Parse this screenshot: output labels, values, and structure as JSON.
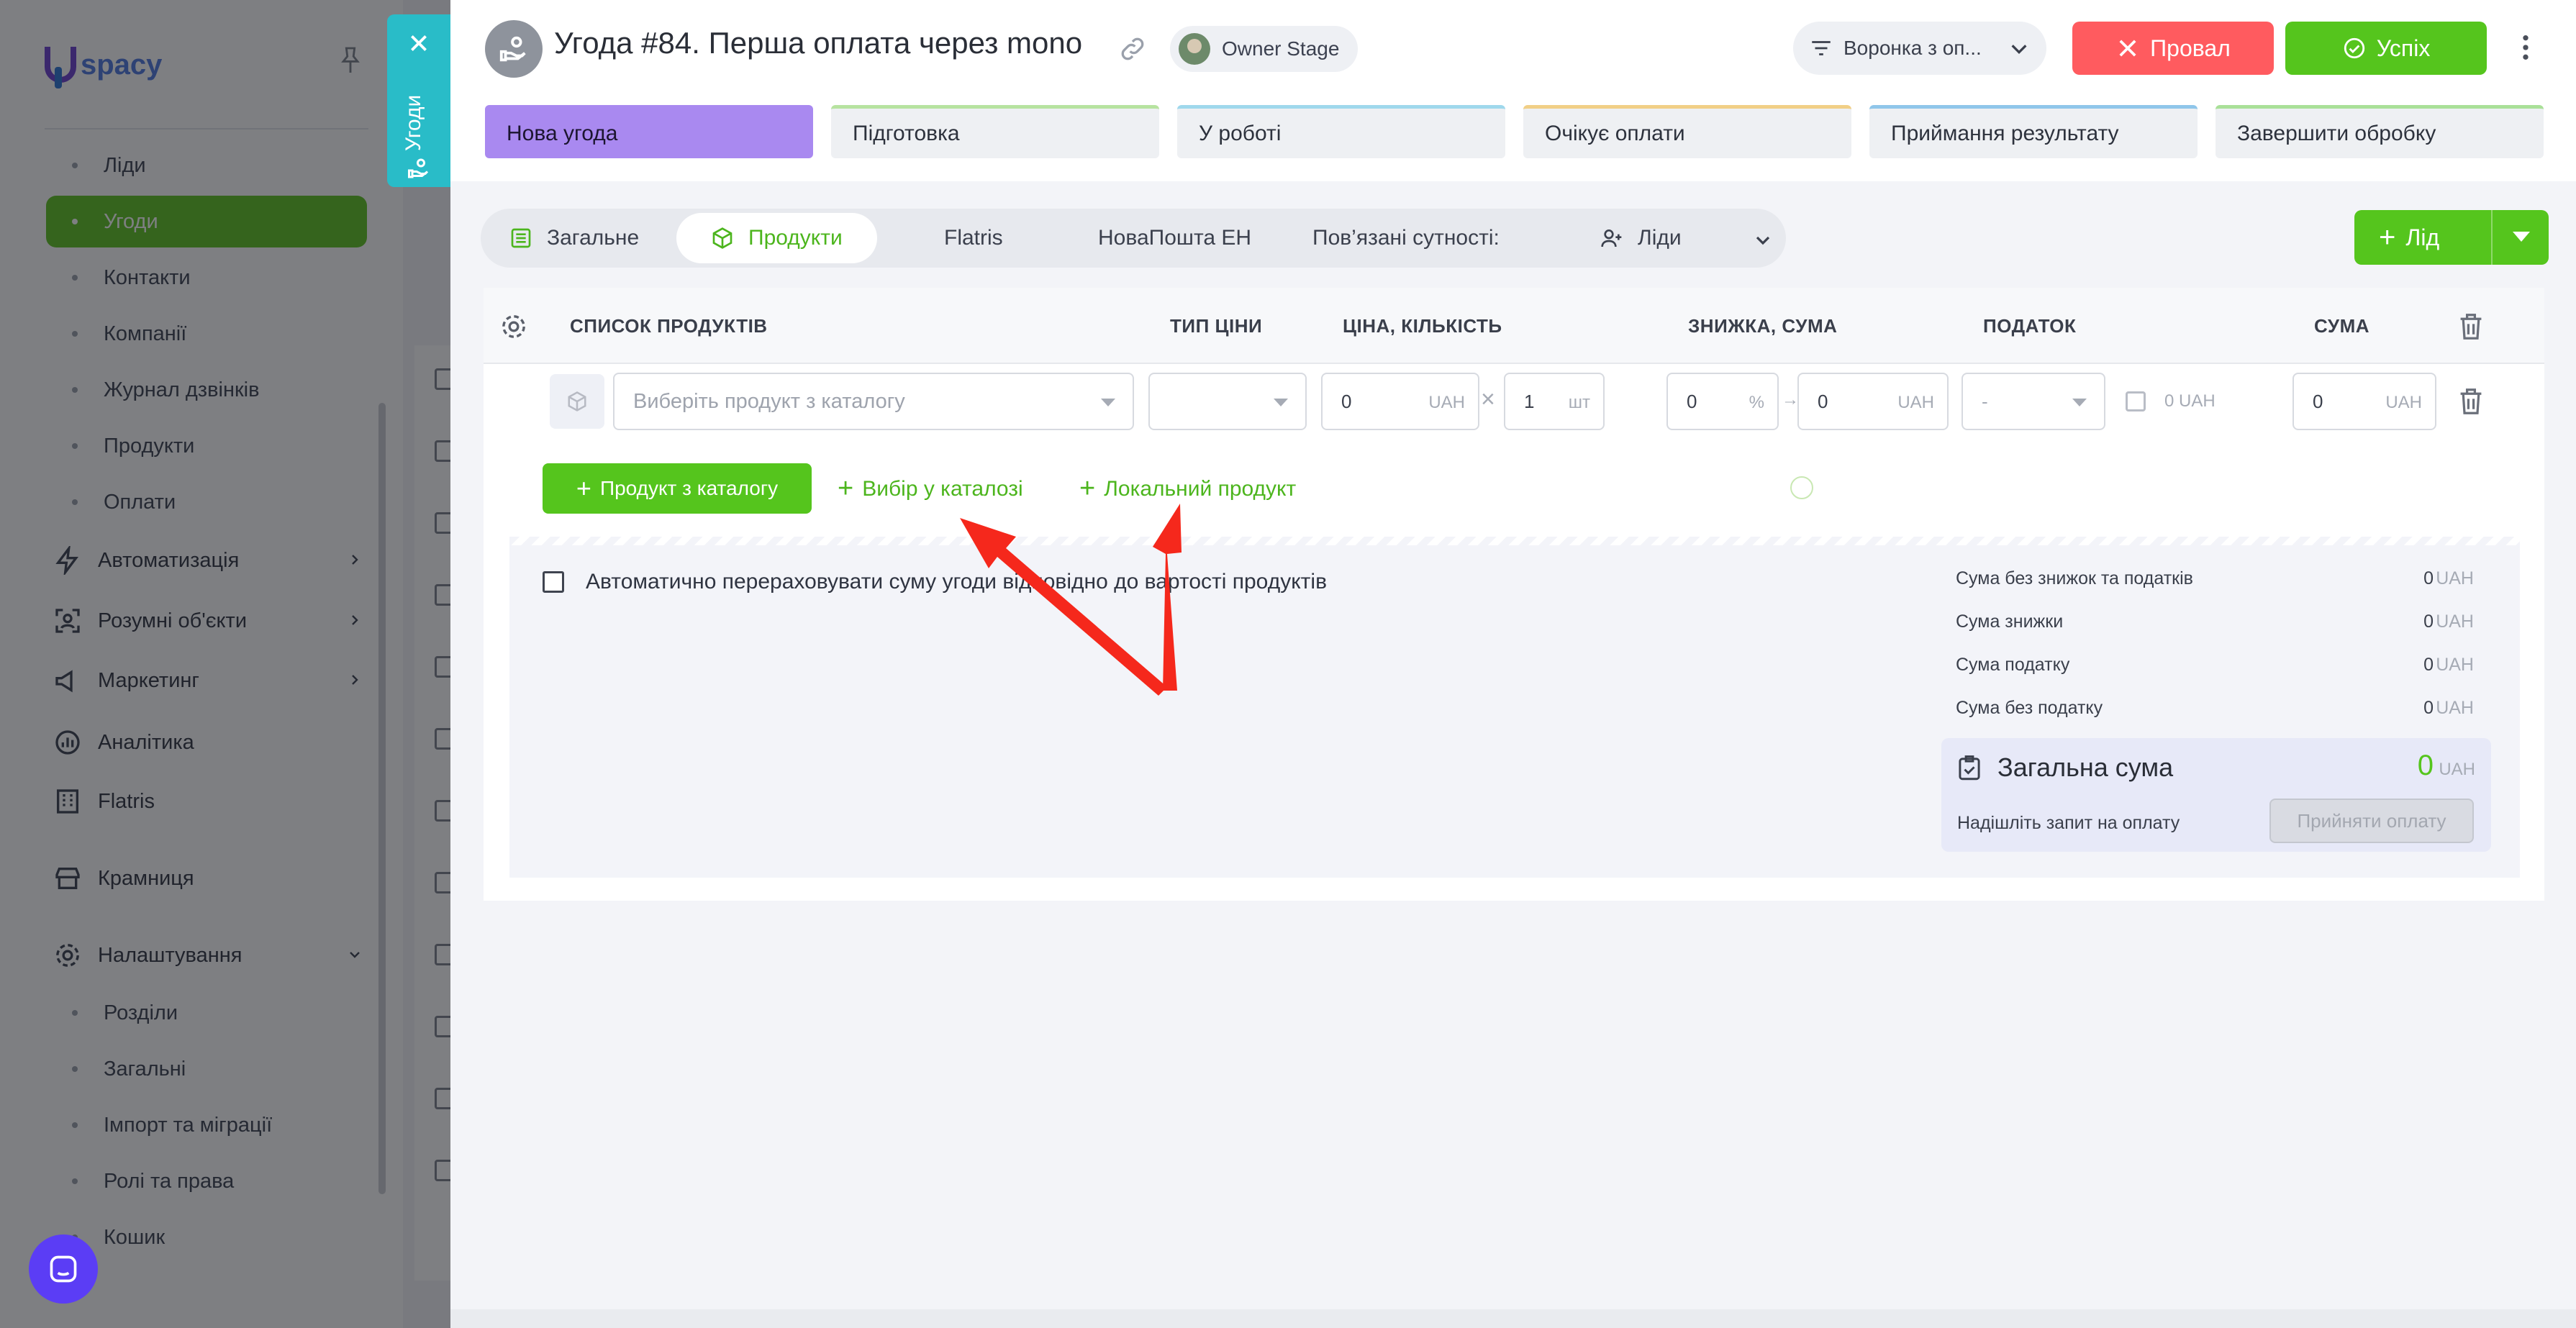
{
  "sidebar": {
    "logo_text": "spacy",
    "items": [
      {
        "label": "Ліди"
      },
      {
        "label": "Угоди"
      },
      {
        "label": "Контакти"
      },
      {
        "label": "Компанії"
      },
      {
        "label": "Журнал дзвінків"
      },
      {
        "label": "Продукти"
      },
      {
        "label": "Оплати"
      }
    ],
    "groups": [
      {
        "label": "Автоматизація"
      },
      {
        "label": "Розумні об'єкти"
      },
      {
        "label": "Маркетинг"
      },
      {
        "label": "Аналітика"
      },
      {
        "label": "Flatris"
      },
      {
        "label": "Крамниця"
      },
      {
        "label": "Налаштування"
      }
    ],
    "settings_items": [
      {
        "label": "Розділи"
      },
      {
        "label": "Загальні"
      },
      {
        "label": "Імпорт та міграції"
      },
      {
        "label": "Ролі та права"
      },
      {
        "label": "Кошик"
      }
    ]
  },
  "side_tab": {
    "label": "Угоди"
  },
  "header": {
    "title": "Угода #84. Перша оплата через mono",
    "owner": "Owner Stage",
    "funnel": "Воронка з оп...",
    "fail_label": "Провал",
    "success_label": "Успіх"
  },
  "stages": [
    {
      "label": "Нова угода",
      "color": "#a989f0"
    },
    {
      "label": "Підготовка",
      "color": "#b7e3a0"
    },
    {
      "label": "У роботі",
      "color": "#9fd8ec"
    },
    {
      "label": "Очікує оплати",
      "color": "#f1cf86"
    },
    {
      "label": "Приймання результату",
      "color": "#8fc6ea"
    },
    {
      "label": "Завершити обробку",
      "color": "#a9e098"
    }
  ],
  "tabs": {
    "general": "Загальне",
    "products": "Продукти",
    "flatris": "Flatris",
    "novaposhta": "НоваПошта ЕН",
    "related": "Пов’язані сутності:",
    "leads": "Ліди"
  },
  "lead_button": "Лід",
  "table": {
    "headers": {
      "list": "СПИСОК ПРОДУКТІВ",
      "price_type": "ТИП ЦІНИ",
      "price_qty": "ЦІНА, КІЛЬКІСТЬ",
      "discount": "ЗНИЖКА, СУМА",
      "tax": "ПОДАТОК",
      "sum": "СУМА"
    },
    "row": {
      "product_placeholder": "Виберіть продукт з каталогу",
      "price": "0",
      "price_currency": "UAH",
      "qty": "1",
      "qty_unit": "шт",
      "discount_pct": "0",
      "discount_unit": "%",
      "discount_sum": "0",
      "discount_currency": "UAH",
      "tax": "-",
      "tax_sum": "0 UAH",
      "sum": "0",
      "sum_currency": "UAH"
    }
  },
  "actions": {
    "catalog_product": "Продукт з каталогу",
    "choose_in_catalog": "Вибір у каталозі",
    "local_product": "Локальний продукт"
  },
  "summary": {
    "auto_recalc": "Автоматично перераховувати суму угоди відповідно до вартості продуктів",
    "rows": [
      {
        "label": "Сума без знижок та податків",
        "value": "0",
        "currency": "UAH"
      },
      {
        "label": "Сума знижки",
        "value": "0",
        "currency": "UAH"
      },
      {
        "label": "Сума податку",
        "value": "0",
        "currency": "UAH"
      },
      {
        "label": "Сума без податку",
        "value": "0",
        "currency": "UAH"
      }
    ],
    "total_label": "Загальна сума",
    "total_value": "0",
    "total_currency": "UAH",
    "pay_request": "Надішліть запит на оплату",
    "accept_payment": "Прийняти оплату"
  },
  "colors": {
    "accent_green": "#55c51d",
    "fail_red": "#ff5b5f",
    "tab_teal": "#29bcc8",
    "annotation_red": "#f5281c"
  }
}
